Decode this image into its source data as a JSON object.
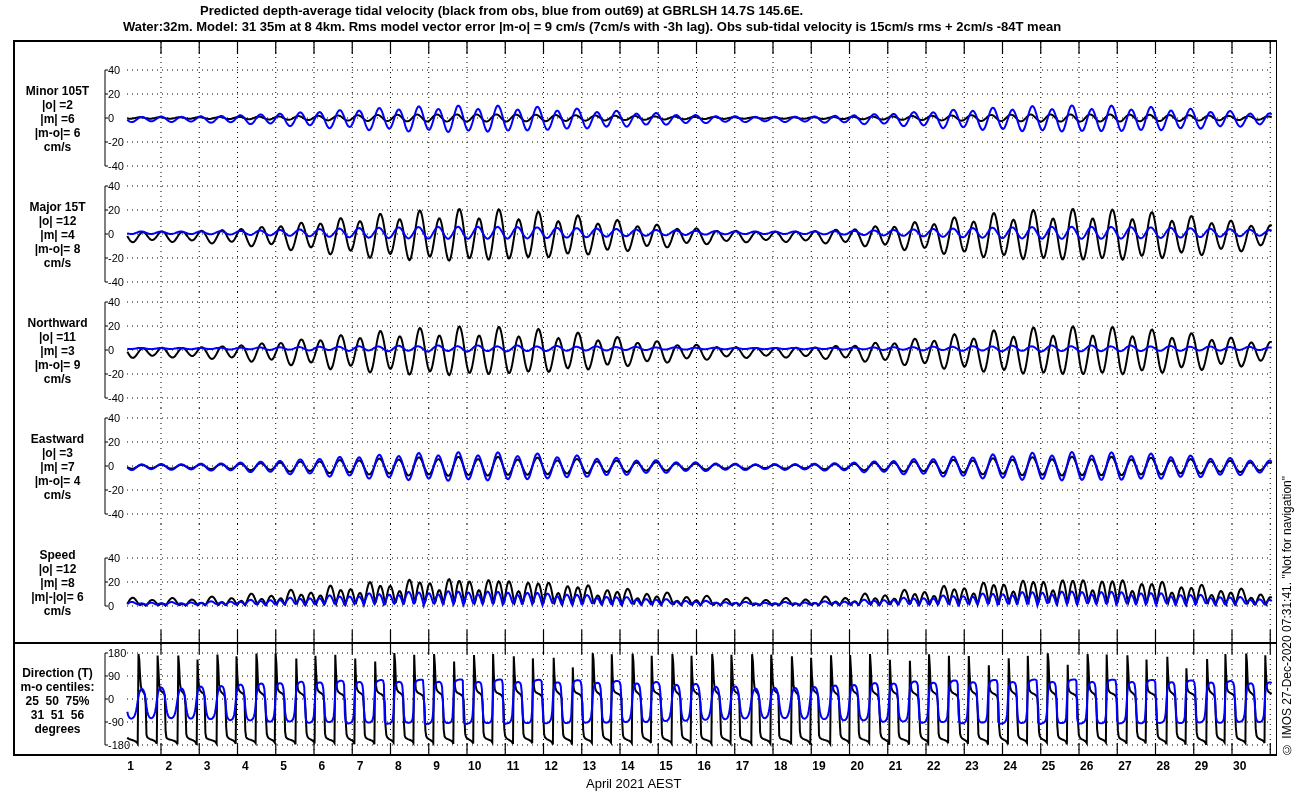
{
  "title": {
    "lines": [
      "Predicted depth-average tidal velocity (black from obs, blue from out69) at GBRLSH 14.7S 145.6E.",
      "Water:32m. Model: 31 35m at 8 4km. Rms model vector error |m-o| = 9 cm/s (7cm/s with -3h lag). Obs sub-tidal velocity is 15cm/s rms + 2cm/s -84T mean"
    ]
  },
  "panels": [
    {
      "kind": "minor",
      "label": [
        "Minor 105T",
        "|o| =2",
        "|m| =6",
        "|m-o|= 6",
        "cm/s"
      ],
      "yticks": [
        "40",
        "20",
        "0",
        "-20",
        "-40"
      ]
    },
    {
      "kind": "major",
      "label": [
        "Major 15T",
        "|o| =12",
        "|m| =4",
        "|m-o|= 8",
        "cm/s"
      ],
      "yticks": [
        "40",
        "20",
        "0",
        "-20",
        "-40"
      ]
    },
    {
      "kind": "north",
      "label": [
        "Northward",
        "|o| =11",
        "|m| =3",
        "|m-o|= 9",
        "cm/s"
      ],
      "yticks": [
        "40",
        "20",
        "0",
        "-20",
        "-40"
      ]
    },
    {
      "kind": "east",
      "label": [
        "Eastward",
        "|o| =3",
        "|m| =7",
        "|m-o|= 4",
        "cm/s"
      ],
      "yticks": [
        "40",
        "20",
        "0",
        "-20",
        "-40"
      ]
    },
    {
      "kind": "speed",
      "label": [
        "Speed",
        "|o| =12",
        "|m| =8",
        "|m|-|o|= 6",
        "cm/s"
      ],
      "yticks": [
        "40",
        "20",
        "0"
      ]
    },
    {
      "kind": "direction",
      "label": [
        "Direction (T)",
        "m-o centiles:",
        "25  50  75%",
        "31  51  56",
        "degrees"
      ],
      "yticks": [
        "180",
        "90",
        "0",
        "-90",
        "-180"
      ]
    }
  ],
  "x_axis": {
    "day_labels": [
      "1",
      "2",
      "3",
      "4",
      "5",
      "6",
      "7",
      "8",
      "9",
      "10",
      "11",
      "12",
      "13",
      "14",
      "15",
      "16",
      "17",
      "18",
      "19",
      "20",
      "21",
      "22",
      "23",
      "24",
      "25",
      "26",
      "27",
      "28",
      "29",
      "30"
    ],
    "label": "April 2021 AEST"
  },
  "credit": "© IMOS 27-Dec-2020 07:31:41. \"Not for navigation\""
}
